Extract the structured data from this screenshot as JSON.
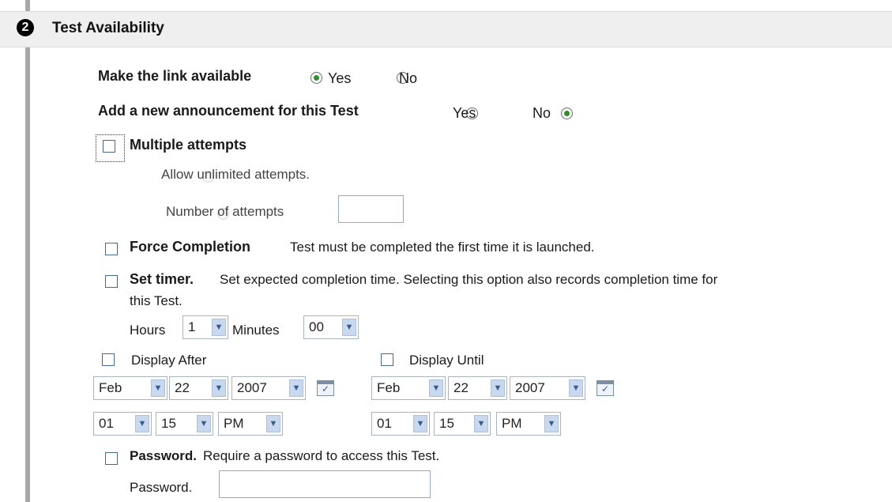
{
  "section": {
    "step_number": "2",
    "title": "Test Availability"
  },
  "make_link": {
    "label": "Make the link available",
    "yes": "Yes",
    "no": "No",
    "selected": "Yes"
  },
  "announcement": {
    "label": "Add a new announcement for this Test",
    "yes": "Yes",
    "no": "No",
    "selected": "No"
  },
  "multiple_attempts": {
    "label": "Multiple attempts",
    "checked": false,
    "unlimited_label": "Allow unlimited attempts.",
    "number_label": "Number of attempts",
    "number_value": ""
  },
  "force_completion": {
    "label": "Force Completion",
    "description": "Test must be completed the first time it is launched.",
    "checked": false
  },
  "timer": {
    "label": "Set timer.",
    "description": "Set expected completion time. Selecting this option also records completion time for",
    "description_cont": "this Test.",
    "hours_label": "Hours",
    "hours_value": "1",
    "minutes_label": "Minutes",
    "minutes_value": "00"
  },
  "display_after": {
    "label": "Display After",
    "month": "Feb",
    "day": "22",
    "year": "2007",
    "hour": "01",
    "minute": "15",
    "ampm": "PM"
  },
  "display_until": {
    "label": "Display Until",
    "month": "Feb",
    "day": "22",
    "year": "2007",
    "hour": "01",
    "minute": "15",
    "ampm": "PM"
  },
  "password": {
    "label": "Password.",
    "description": "Require a password to access this Test.",
    "field_label": "Password.",
    "value": ""
  },
  "icons": {
    "calendar": "calendar-icon",
    "dropdown": "chevron-down-icon"
  },
  "colors": {
    "header_bg": "#efefef",
    "radio_selected": "#2f8f2f",
    "select_arrow_bg": "#c8d9ef"
  }
}
